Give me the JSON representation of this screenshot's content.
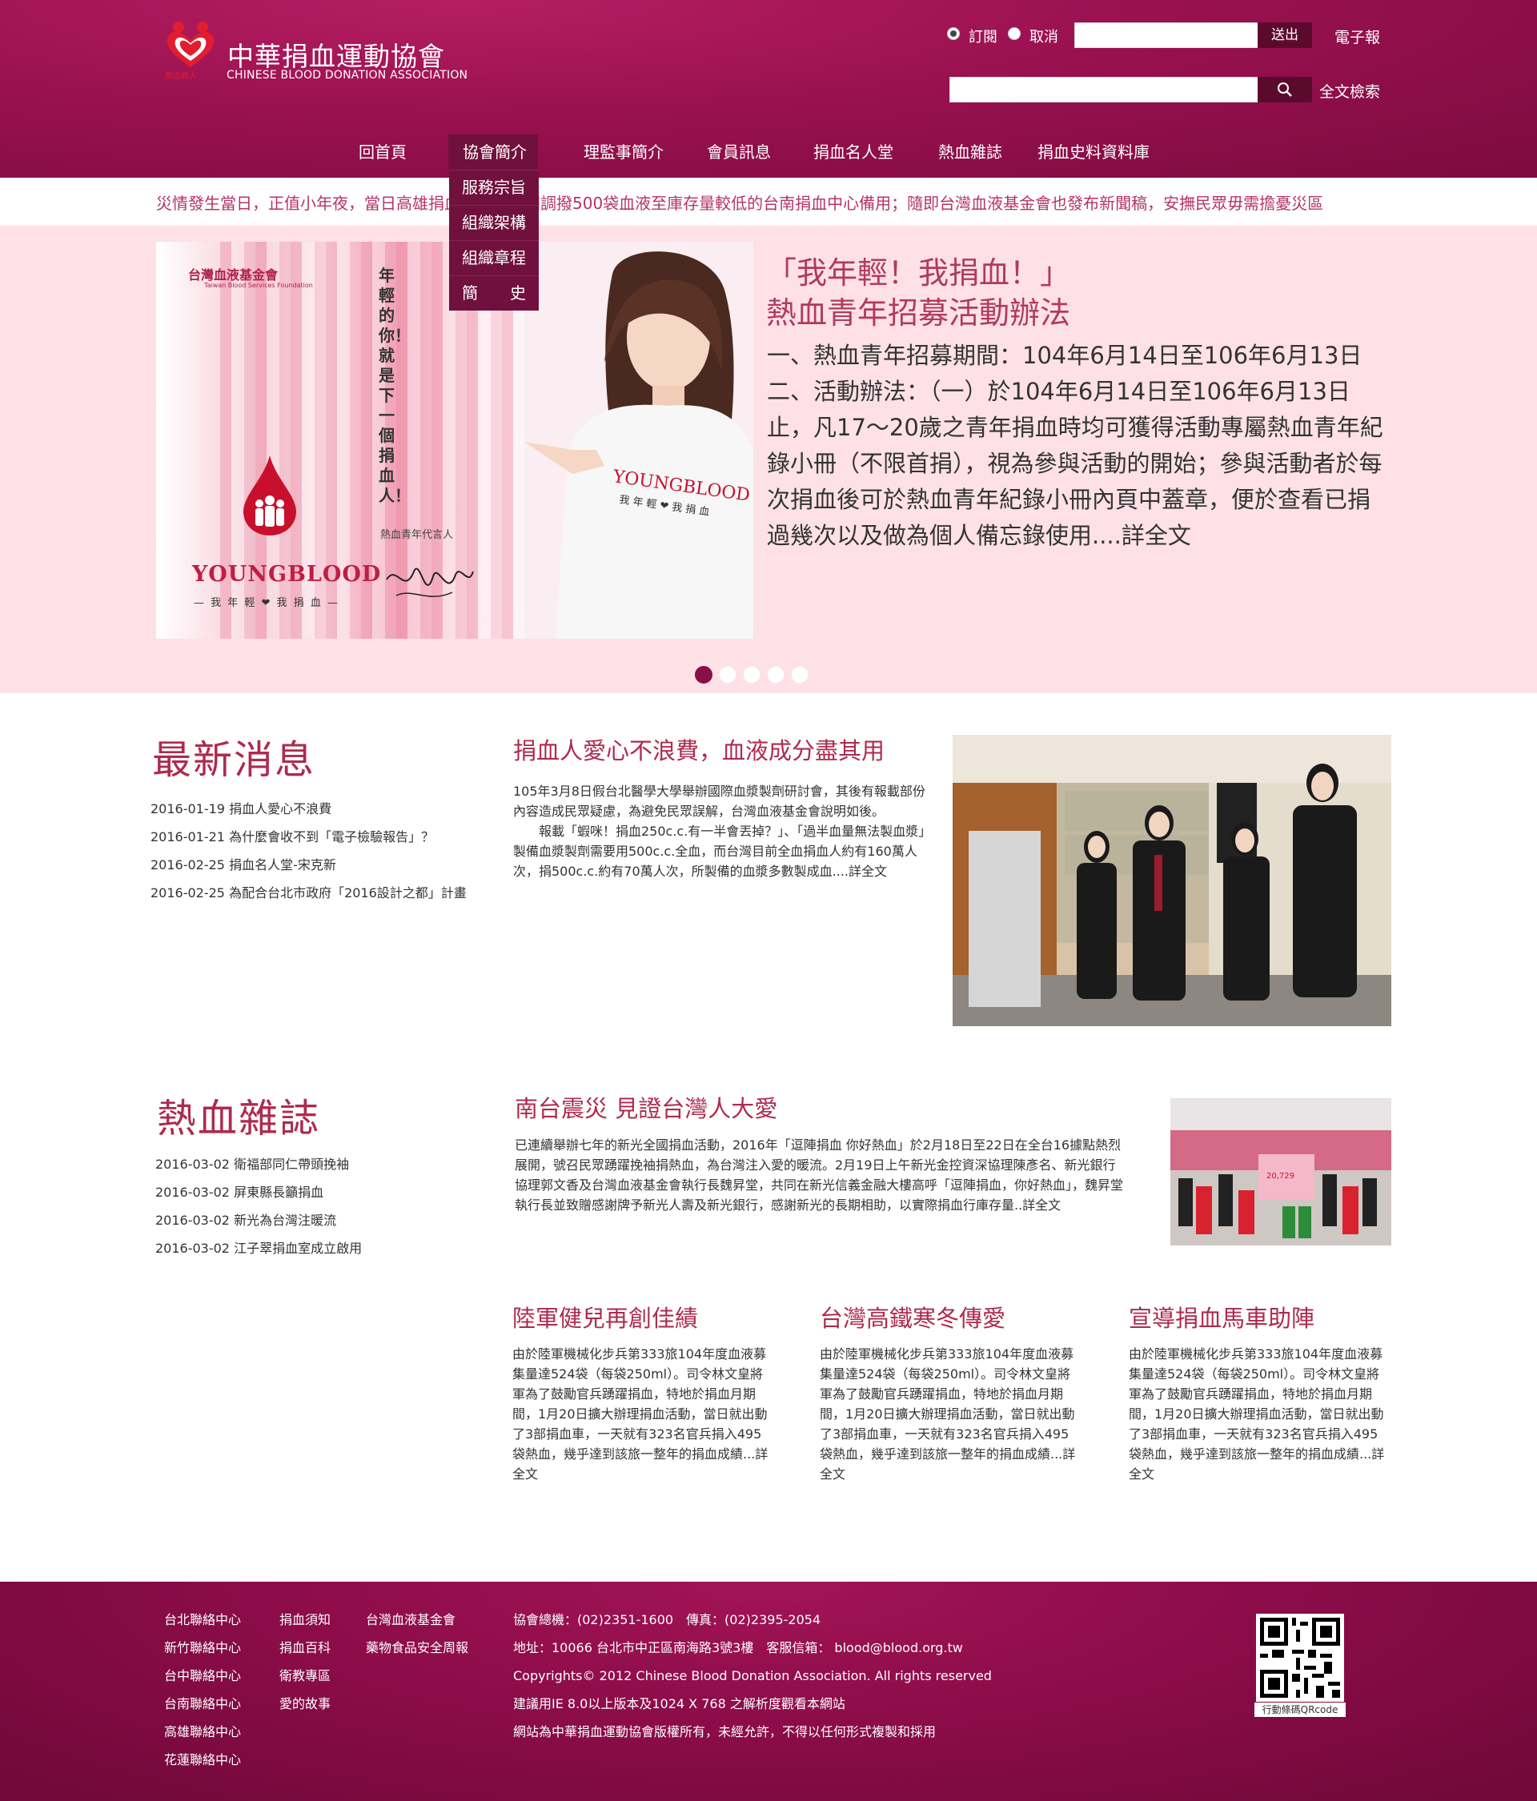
{
  "header": {
    "logo_title": "中華捐血運動協會",
    "logo_subtitle": "CHINESE BLOOD DONATION ASSOCIATION",
    "logo_small_text": "捐血救人",
    "subscribe_label": "訂閱",
    "unsubscribe_label": "取消",
    "send_button": "送出",
    "newsletter_link": "電子報",
    "fulltext_link": "全文檢索",
    "subscribe_selected": "訂閱"
  },
  "nav": {
    "items": [
      "回首頁",
      "協會簡介",
      "理監事簡介",
      "會員訊息",
      "捐血名人堂",
      "熱血雜誌",
      "捐血史料資料庫"
    ],
    "active": "協會簡介",
    "dropdown": [
      "服務宗旨",
      "組織架構",
      "組織章程",
      "簡　　史"
    ]
  },
  "ticker": {
    "text": "災情發生當日，正值小年夜，當日高雄捐血中心一時間調撥500袋血液至庫存量較低的台南捐血中心備用；隨即台灣血液基金會也發布新聞稿，安撫民眾毋需擔憂災區"
  },
  "banner": {
    "title_line1": "「我年輕！我捐血！」",
    "title_line2": "熱血青年招募活動辦法",
    "body": "一、熱血青年招募期間：104年6月14日至106年6月13日 二、活動辦法：（一）於104年6月14日至106年6月13日止，凡17～20歲之青年捐血時均可獲得活動專屬熱血青年紀錄小冊（不限首捐），視為參與活動的開始；參與活動者於每次捐血後可於熱血青年紀錄小冊內頁中蓋章，便於查看已捐過幾次以及做為個人備忘錄使用....詳全文",
    "poster": {
      "org": "台灣血液基金會",
      "org_en": "Taiwan Blood Services Foundation",
      "vertical_slogan": "年輕的你！就是下一個捐血人！",
      "brand": "YOUNGBLOOD",
      "brand_sub": "— 我 年 輕 ❤ 我 捐 血 —",
      "spokesperson": "熱血青年代言人",
      "shirt_brand": "YOUNGBLOOD",
      "shirt_sub": "我 年 輕 ❤ 我 捐 血"
    },
    "slides": 5,
    "active_slide": 1
  },
  "news": {
    "section_title": "最新消息",
    "items": [
      "2016-01-19 捐血人愛心不浪費",
      "2016-01-21 為什麼會收不到「電子檢驗報告」？",
      "2016-02-25 捐血名人堂-宋克新",
      "2016-02-25 為配合台北市政府「2016設計之都」計畫"
    ],
    "feature_title": "捐血人愛心不浪費，血液成分盡其用",
    "feature_body1": "105年3月8日假台北醫學大學舉辦國際血漿製劑研討會，其後有報載部份內容造成民眾疑慮，為避免民眾誤解，台灣血液基金會說明如後。",
    "feature_body2": "報載「蝦咪！捐血250c.c.有一半會丟掉？」、「過半血量無法製血漿」製備血漿製劑需要用500c.c.全血，而台灣目前全血捐血人約有160萬人次，捐500c.c.約有70萬人次，所製備的血漿多數製成血....詳全文"
  },
  "magazine": {
    "section_title": "熱血雜誌",
    "items": [
      "2016-03-02 衛福部同仁帶頭挽袖",
      "2016-03-02 屏東縣長籲捐血",
      "2016-03-02 新光為台灣注暖流",
      "2016-03-02 江子翠捐血室成立啟用"
    ],
    "feature_title": "南台震災 見證台灣人大愛",
    "feature_body": "已連續舉辦七年的新光全國捐血活動，2016年「逗陣捐血 你好熱血」於2月18日至22日在全台16據點熱烈展開，號召民眾踴躍挽袖捐熱血，為台灣注入愛的暖流。2月19日上午新光金控資深協理陳彥名、新光銀行協理郭文香及台灣血液基金會執行長魏昇堂，共同在新光信義金融大樓高呼「逗陣捐血，你好熱血」，魏昇堂執行長並致贈感謝牌予新光人壽及新光銀行，感謝新光的長期相助，以實際捐血行庫存量..詳全文",
    "cards": [
      {
        "title": "陸軍健兒再創佳績",
        "body": "由於陸軍機械化步兵第333旅104年度血液募集量達524袋（每袋250ml）。司令林文皇將軍為了鼓勵官兵踴躍捐血，特地於捐血月期間，1月20日擴大辦理捐血活動，當日就出動了3部捐血車，一天就有323名官兵捐入495袋熱血，幾乎達到該旅一整年的捐血成績...詳全文"
      },
      {
        "title": "台灣高鐵寒冬傳愛",
        "body": "由於陸軍機械化步兵第333旅104年度血液募集量達524袋（每袋250ml）。司令林文皇將軍為了鼓勵官兵踴躍捐血，特地於捐血月期間，1月20日擴大辦理捐血活動，當日就出動了3部捐血車，一天就有323名官兵捐入495袋熱血，幾乎達到該旅一整年的捐血成績...詳全文"
      },
      {
        "title": "宣導捐血馬車助陣",
        "body": "由於陸軍機械化步兵第333旅104年度血液募集量達524袋（每袋250ml）。司令林文皇將軍為了鼓勵官兵踴躍捐血，特地於捐血月期間，1月20日擴大辦理捐血活動，當日就出動了3部捐血車，一天就有323名官兵捐入495袋熱血，幾乎達到該旅一整年的捐血成績...詳全文"
      }
    ]
  },
  "footer": {
    "col1": [
      "台北聯絡中心",
      "新竹聯絡中心",
      "台中聯絡中心",
      "台南聯絡中心",
      "高雄聯絡中心",
      "花蓮聯絡中心"
    ],
    "col2": [
      "捐血須知",
      "捐血百科",
      "衛教專區",
      "愛的故事"
    ],
    "col3": [
      "台灣血液基金會",
      "藥物食品安全周報"
    ],
    "info": [
      "協會總機：(02)2351-1600　傳真：(02)2395-2054",
      "地址：10066 台北市中正區南海路3號3樓　客服信箱： blood@blood.org.tw",
      "Copyrights© 2012 Chinese Blood Donation Association. All rights reserved",
      "建議用IE 8.0以上版本及1024 X 768 之解析度觀看本網站",
      "網站為中華捐血運動協會版權所有，未經允許，不得以任何形式複製和採用"
    ],
    "qr_caption": "行動條碼QRcode"
  },
  "colors": {
    "header": "#9a1150",
    "accent_text": "#ae2a4f",
    "banner_bg": "#fde1e7",
    "button_dark": "#5b0a2e"
  }
}
